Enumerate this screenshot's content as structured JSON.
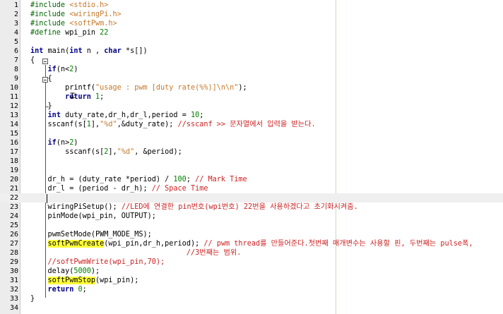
{
  "editor": {
    "lines": [
      {
        "n": "1",
        "segs": [
          [
            "pp",
            "#include "
          ],
          [
            "str",
            "<stdio.h>"
          ]
        ]
      },
      {
        "n": "2",
        "segs": [
          [
            "pp",
            "#include "
          ],
          [
            "str",
            "<wiringPi.h>"
          ]
        ]
      },
      {
        "n": "3",
        "segs": [
          [
            "pp",
            "#include "
          ],
          [
            "str",
            "<softPwm.h>"
          ]
        ]
      },
      {
        "n": "4",
        "segs": [
          [
            "pp",
            "#define "
          ],
          [
            "",
            "wpi_pin "
          ],
          [
            "num",
            "22"
          ]
        ]
      },
      {
        "n": "5",
        "segs": []
      },
      {
        "n": "6",
        "segs": [
          [
            "kw",
            "int"
          ],
          [
            "",
            " main("
          ],
          [
            "kw",
            "int"
          ],
          [
            "",
            " n , "
          ],
          [
            "kw",
            "char"
          ],
          [
            "",
            " *s[])"
          ]
        ]
      },
      {
        "n": "7",
        "segs": [
          [
            "",
            "{"
          ]
        ]
      },
      {
        "n": "8",
        "segs": [
          [
            "",
            "    "
          ],
          [
            "kw",
            "if"
          ],
          [
            "",
            "(n<"
          ],
          [
            "num",
            "2"
          ],
          [
            "",
            ")"
          ]
        ]
      },
      {
        "n": "9",
        "segs": [
          [
            "",
            "    {"
          ]
        ]
      },
      {
        "n": "10",
        "segs": [
          [
            "",
            "        printf("
          ],
          [
            "str",
            "\"usage : pwm [duty rate(%%)]\\n\\n\""
          ],
          [
            "",
            ");"
          ]
        ]
      },
      {
        "n": "11",
        "segs": [
          [
            "",
            "        "
          ],
          [
            "kw",
            "return"
          ],
          [
            "",
            " "
          ],
          [
            "num",
            "1"
          ],
          [
            "",
            ";"
          ]
        ]
      },
      {
        "n": "12",
        "segs": [
          [
            "",
            "    }"
          ]
        ]
      },
      {
        "n": "13",
        "segs": [
          [
            "",
            "    "
          ],
          [
            "kw",
            "int"
          ],
          [
            "",
            " duty_rate,dr_h,dr_l,period = "
          ],
          [
            "num",
            "10"
          ],
          [
            "",
            ";"
          ]
        ]
      },
      {
        "n": "14",
        "segs": [
          [
            "",
            "    sscanf(s["
          ],
          [
            "num",
            "1"
          ],
          [
            "",
            "],"
          ],
          [
            "str",
            "\"%d\""
          ],
          [
            "",
            ",&duty_rate); "
          ],
          [
            "cmt",
            "//sscanf >> 문자열에서 입력을 받는다."
          ]
        ]
      },
      {
        "n": "15",
        "segs": []
      },
      {
        "n": "16",
        "segs": [
          [
            "",
            "    "
          ],
          [
            "kw",
            "if"
          ],
          [
            "",
            "(n>"
          ],
          [
            "num",
            "2"
          ],
          [
            "",
            ")"
          ]
        ]
      },
      {
        "n": "17",
        "segs": [
          [
            "",
            "        sscanf(s["
          ],
          [
            "num",
            "2"
          ],
          [
            "",
            "],"
          ],
          [
            "str",
            "\"%d\""
          ],
          [
            "",
            ", &period);"
          ]
        ]
      },
      {
        "n": "18",
        "segs": []
      },
      {
        "n": "19",
        "segs": []
      },
      {
        "n": "20",
        "segs": [
          [
            "",
            "    dr_h = (duty_rate *period) / "
          ],
          [
            "num",
            "100"
          ],
          [
            "",
            "; "
          ],
          [
            "cmt",
            "// Mark Time"
          ]
        ]
      },
      {
        "n": "21",
        "segs": [
          [
            "",
            "    dr_l = (period - dr_h); "
          ],
          [
            "cmt",
            "// Space Time"
          ]
        ]
      },
      {
        "n": "22",
        "segs": [],
        "current": true
      },
      {
        "n": "23",
        "segs": [
          [
            "",
            "    wiringPiSetup(); "
          ],
          [
            "cmt",
            "//LED에 연결한 pin번호(wpi번호) 22번을 사용하겠다고 초기화시켜줌."
          ]
        ]
      },
      {
        "n": "24",
        "segs": [
          [
            "",
            "    pinMode(wpi_pin, OUTPUT);"
          ]
        ]
      },
      {
        "n": "25",
        "segs": []
      },
      {
        "n": "26",
        "segs": [
          [
            "",
            "    pwmSetMode(PWM_MODE_MS);"
          ]
        ]
      },
      {
        "n": "27",
        "segs": [
          [
            "",
            "    "
          ],
          [
            "hl",
            "softPwmCreate"
          ],
          [
            "",
            "(wpi_pin,dr_h,period); "
          ],
          [
            "cmt",
            "// pwm thread를 만들어준다.첫번째 매개변수는 사용할 핀, 두번째는 pulse폭,"
          ]
        ]
      },
      {
        "n": "28",
        "segs": [
          [
            "",
            "                                    "
          ],
          [
            "cmt",
            "//3번째는 범위."
          ]
        ]
      },
      {
        "n": "29",
        "segs": [
          [
            "",
            "    "
          ],
          [
            "cmt",
            "//softPwmWrite(wpi_pin,70);"
          ]
        ]
      },
      {
        "n": "30",
        "segs": [
          [
            "",
            "    delay("
          ],
          [
            "num",
            "5000"
          ],
          [
            "",
            ");"
          ]
        ]
      },
      {
        "n": "31",
        "segs": [
          [
            "",
            "    "
          ],
          [
            "hl",
            "softPwmStop"
          ],
          [
            "",
            "(wpi_pin);"
          ]
        ]
      },
      {
        "n": "32",
        "segs": [
          [
            "",
            "    "
          ],
          [
            "kw",
            "return"
          ],
          [
            "",
            " "
          ],
          [
            "num",
            "0"
          ],
          [
            "",
            ";"
          ]
        ]
      },
      {
        "n": "33",
        "segs": [
          [
            "",
            "}"
          ]
        ]
      },
      {
        "n": "34",
        "segs": []
      }
    ]
  },
  "colors": {
    "gutter": "#ececec",
    "keyword": "#00008b",
    "preprocessor": "#006400",
    "string": "#c47a2c",
    "number": "#008000",
    "comment": "#cc2222",
    "highlight": "#ffff3a",
    "current_line": "#efefef",
    "edge_line": "#c4dcc4"
  }
}
